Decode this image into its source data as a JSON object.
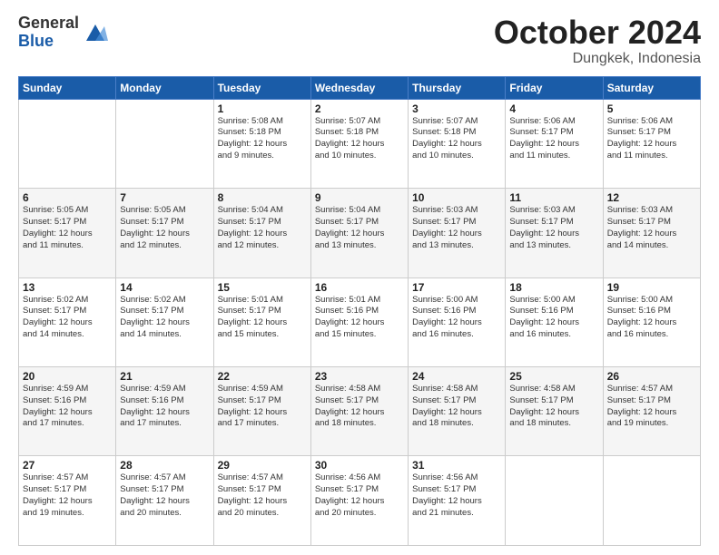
{
  "header": {
    "logo_general": "General",
    "logo_blue": "Blue",
    "month_title": "October 2024",
    "location": "Dungkek, Indonesia"
  },
  "weekdays": [
    "Sunday",
    "Monday",
    "Tuesday",
    "Wednesday",
    "Thursday",
    "Friday",
    "Saturday"
  ],
  "weeks": [
    [
      {
        "day": "",
        "info": ""
      },
      {
        "day": "",
        "info": ""
      },
      {
        "day": "1",
        "info": "Sunrise: 5:08 AM\nSunset: 5:18 PM\nDaylight: 12 hours\nand 9 minutes."
      },
      {
        "day": "2",
        "info": "Sunrise: 5:07 AM\nSunset: 5:18 PM\nDaylight: 12 hours\nand 10 minutes."
      },
      {
        "day": "3",
        "info": "Sunrise: 5:07 AM\nSunset: 5:18 PM\nDaylight: 12 hours\nand 10 minutes."
      },
      {
        "day": "4",
        "info": "Sunrise: 5:06 AM\nSunset: 5:17 PM\nDaylight: 12 hours\nand 11 minutes."
      },
      {
        "day": "5",
        "info": "Sunrise: 5:06 AM\nSunset: 5:17 PM\nDaylight: 12 hours\nand 11 minutes."
      }
    ],
    [
      {
        "day": "6",
        "info": "Sunrise: 5:05 AM\nSunset: 5:17 PM\nDaylight: 12 hours\nand 11 minutes."
      },
      {
        "day": "7",
        "info": "Sunrise: 5:05 AM\nSunset: 5:17 PM\nDaylight: 12 hours\nand 12 minutes."
      },
      {
        "day": "8",
        "info": "Sunrise: 5:04 AM\nSunset: 5:17 PM\nDaylight: 12 hours\nand 12 minutes."
      },
      {
        "day": "9",
        "info": "Sunrise: 5:04 AM\nSunset: 5:17 PM\nDaylight: 12 hours\nand 13 minutes."
      },
      {
        "day": "10",
        "info": "Sunrise: 5:03 AM\nSunset: 5:17 PM\nDaylight: 12 hours\nand 13 minutes."
      },
      {
        "day": "11",
        "info": "Sunrise: 5:03 AM\nSunset: 5:17 PM\nDaylight: 12 hours\nand 13 minutes."
      },
      {
        "day": "12",
        "info": "Sunrise: 5:03 AM\nSunset: 5:17 PM\nDaylight: 12 hours\nand 14 minutes."
      }
    ],
    [
      {
        "day": "13",
        "info": "Sunrise: 5:02 AM\nSunset: 5:17 PM\nDaylight: 12 hours\nand 14 minutes."
      },
      {
        "day": "14",
        "info": "Sunrise: 5:02 AM\nSunset: 5:17 PM\nDaylight: 12 hours\nand 14 minutes."
      },
      {
        "day": "15",
        "info": "Sunrise: 5:01 AM\nSunset: 5:17 PM\nDaylight: 12 hours\nand 15 minutes."
      },
      {
        "day": "16",
        "info": "Sunrise: 5:01 AM\nSunset: 5:16 PM\nDaylight: 12 hours\nand 15 minutes."
      },
      {
        "day": "17",
        "info": "Sunrise: 5:00 AM\nSunset: 5:16 PM\nDaylight: 12 hours\nand 16 minutes."
      },
      {
        "day": "18",
        "info": "Sunrise: 5:00 AM\nSunset: 5:16 PM\nDaylight: 12 hours\nand 16 minutes."
      },
      {
        "day": "19",
        "info": "Sunrise: 5:00 AM\nSunset: 5:16 PM\nDaylight: 12 hours\nand 16 minutes."
      }
    ],
    [
      {
        "day": "20",
        "info": "Sunrise: 4:59 AM\nSunset: 5:16 PM\nDaylight: 12 hours\nand 17 minutes."
      },
      {
        "day": "21",
        "info": "Sunrise: 4:59 AM\nSunset: 5:16 PM\nDaylight: 12 hours\nand 17 minutes."
      },
      {
        "day": "22",
        "info": "Sunrise: 4:59 AM\nSunset: 5:17 PM\nDaylight: 12 hours\nand 17 minutes."
      },
      {
        "day": "23",
        "info": "Sunrise: 4:58 AM\nSunset: 5:17 PM\nDaylight: 12 hours\nand 18 minutes."
      },
      {
        "day": "24",
        "info": "Sunrise: 4:58 AM\nSunset: 5:17 PM\nDaylight: 12 hours\nand 18 minutes."
      },
      {
        "day": "25",
        "info": "Sunrise: 4:58 AM\nSunset: 5:17 PM\nDaylight: 12 hours\nand 18 minutes."
      },
      {
        "day": "26",
        "info": "Sunrise: 4:57 AM\nSunset: 5:17 PM\nDaylight: 12 hours\nand 19 minutes."
      }
    ],
    [
      {
        "day": "27",
        "info": "Sunrise: 4:57 AM\nSunset: 5:17 PM\nDaylight: 12 hours\nand 19 minutes."
      },
      {
        "day": "28",
        "info": "Sunrise: 4:57 AM\nSunset: 5:17 PM\nDaylight: 12 hours\nand 20 minutes."
      },
      {
        "day": "29",
        "info": "Sunrise: 4:57 AM\nSunset: 5:17 PM\nDaylight: 12 hours\nand 20 minutes."
      },
      {
        "day": "30",
        "info": "Sunrise: 4:56 AM\nSunset: 5:17 PM\nDaylight: 12 hours\nand 20 minutes."
      },
      {
        "day": "31",
        "info": "Sunrise: 4:56 AM\nSunset: 5:17 PM\nDaylight: 12 hours\nand 21 minutes."
      },
      {
        "day": "",
        "info": ""
      },
      {
        "day": "",
        "info": ""
      }
    ]
  ]
}
